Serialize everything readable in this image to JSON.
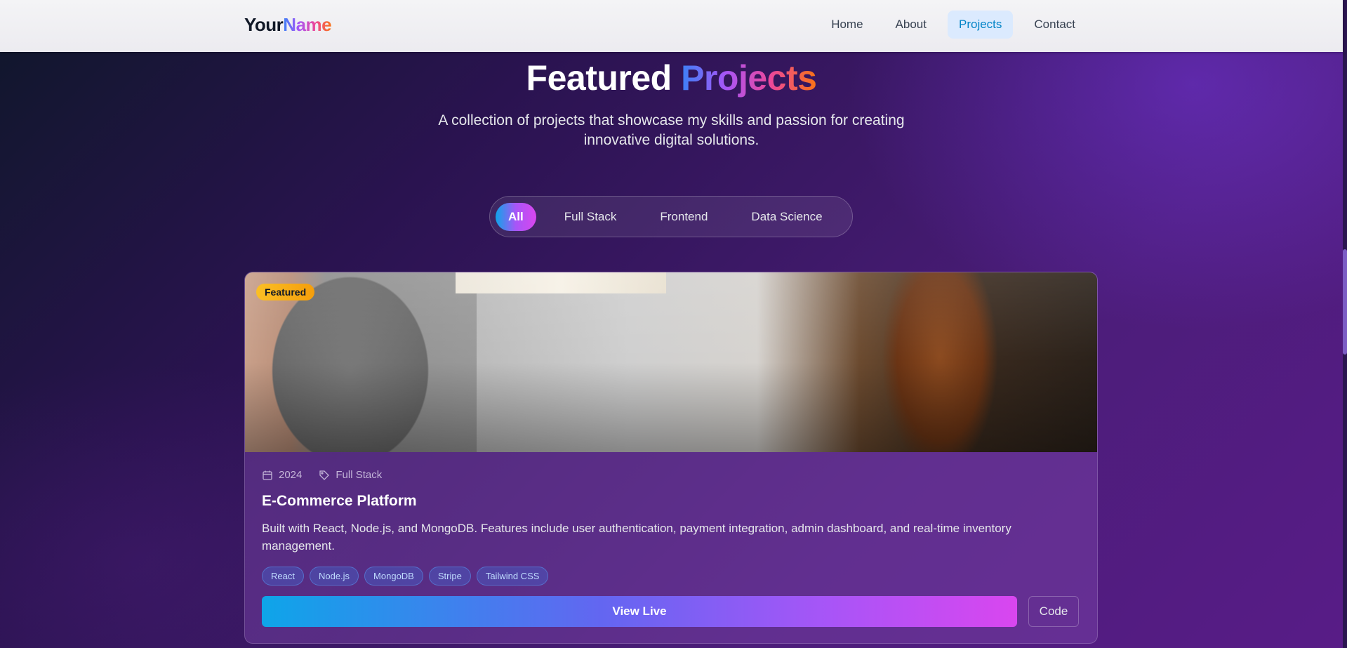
{
  "nav": {
    "logo_part1": "Your",
    "logo_part2": "Name",
    "links": [
      "Home",
      "About",
      "Projects",
      "Contact"
    ],
    "active_link": "Projects"
  },
  "hero": {
    "title_part1": "Featured",
    "title_part2": "Projects",
    "subtitle": "A collection of projects that showcase my skills and passion for creating innovative digital solutions."
  },
  "filters": {
    "items": [
      "All",
      "Full Stack",
      "Frontend",
      "Data Science"
    ],
    "active": "All"
  },
  "project": {
    "badge": "Featured",
    "year": "2024",
    "category": "Full Stack",
    "title": "E-Commerce Platform",
    "description": "Built with React, Node.js, and MongoDB. Features include user authentication, payment integration, admin dashboard, and real-time inventory management.",
    "tags": [
      "React",
      "Node.js",
      "MongoDB",
      "Stripe",
      "Tailwind CSS"
    ],
    "live_label": "View Live",
    "code_label": "Code",
    "icons": {
      "year": "calendar-icon",
      "category": "tag-icon"
    }
  },
  "colors": {
    "accent_blue": "#0ea5e9",
    "accent_purple": "#a855f7",
    "accent_pink": "#d946ef",
    "badge_yellow": "#fbbf24",
    "nav_active_bg": "#dbeafe"
  }
}
